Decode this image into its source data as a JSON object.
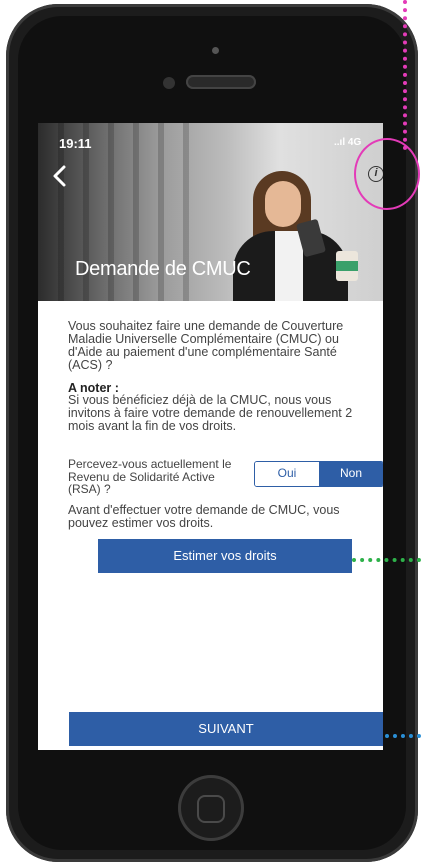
{
  "status_bar": {
    "time": "19:11",
    "signal": "..ıl 4G"
  },
  "header": {
    "back_icon": "chevron-left-icon",
    "info_icon": "info-icon",
    "title": "Demande de CMUC"
  },
  "content": {
    "intro": "Vous souhaitez faire une demande de Couverture Maladie Universelle Complémentaire (CMUC) ou d'Aide au paiement d'une complémentaire Santé (ACS) ?",
    "note_title": "A noter :",
    "note_text": "Si vous bénéficiez déjà de la CMUC, nous vous invitons à faire votre demande de renouvellement 2 mois avant la fin de vos droits.",
    "rsa_question": "Percevez-vous actuellement le Revenu de Solidarité Active (RSA) ?",
    "rsa_toggle": {
      "oui": "Oui",
      "non": "Non",
      "selected": "Non"
    },
    "avant_text": "Avant d'effectuer votre demande de CMUC, vous pouvez estimer vos droits.",
    "estimate_button": "Estimer vos droits",
    "next_button": "SUIVANT"
  },
  "colors": {
    "primary": "#2e5ea6",
    "annotation_magenta": "#e33bb8",
    "annotation_green": "#2eb14a",
    "annotation_blue": "#2a8fd6"
  }
}
